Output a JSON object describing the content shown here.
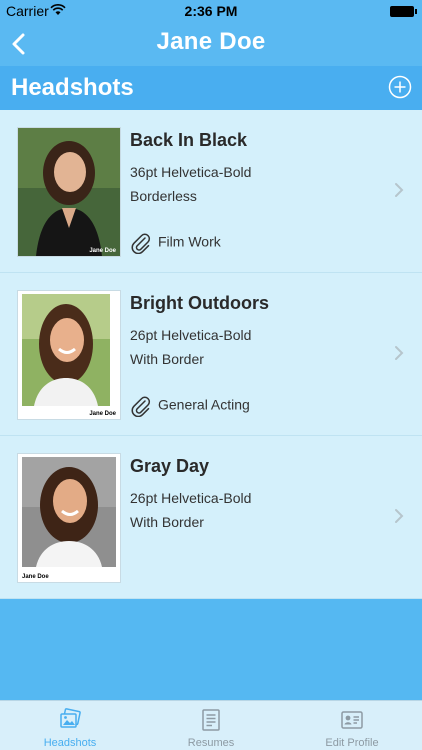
{
  "status_bar": {
    "carrier": "Carrier",
    "time": "2:36 PM"
  },
  "nav": {
    "title": "Jane Doe",
    "back_icon": "chevron-left-icon"
  },
  "section": {
    "title": "Headshots",
    "add_icon": "plus-circle-icon"
  },
  "headshots": [
    {
      "title": "Back In Black",
      "font": "36pt Helvetica-Bold",
      "style": "Borderless",
      "tag": "Film Work",
      "caption": "Jane Doe"
    },
    {
      "title": "Bright Outdoors",
      "font": "26pt Helvetica-Bold",
      "style": "With Border",
      "tag": "General Acting",
      "caption": "Jane Doe"
    },
    {
      "title": "Gray Day",
      "font": "26pt Helvetica-Bold",
      "style": "With Border",
      "tag": "",
      "caption": "Jane Doe"
    }
  ],
  "tabs": [
    {
      "label": "Headshots",
      "icon": "photos-icon",
      "active": true
    },
    {
      "label": "Resumes",
      "icon": "document-icon",
      "active": false
    },
    {
      "label": "Edit Profile",
      "icon": "profile-card-icon",
      "active": false
    }
  ],
  "colors": {
    "accent": "#5ab9f2",
    "row_bg": "#d4f0fb",
    "active_tab": "#48aef0"
  }
}
